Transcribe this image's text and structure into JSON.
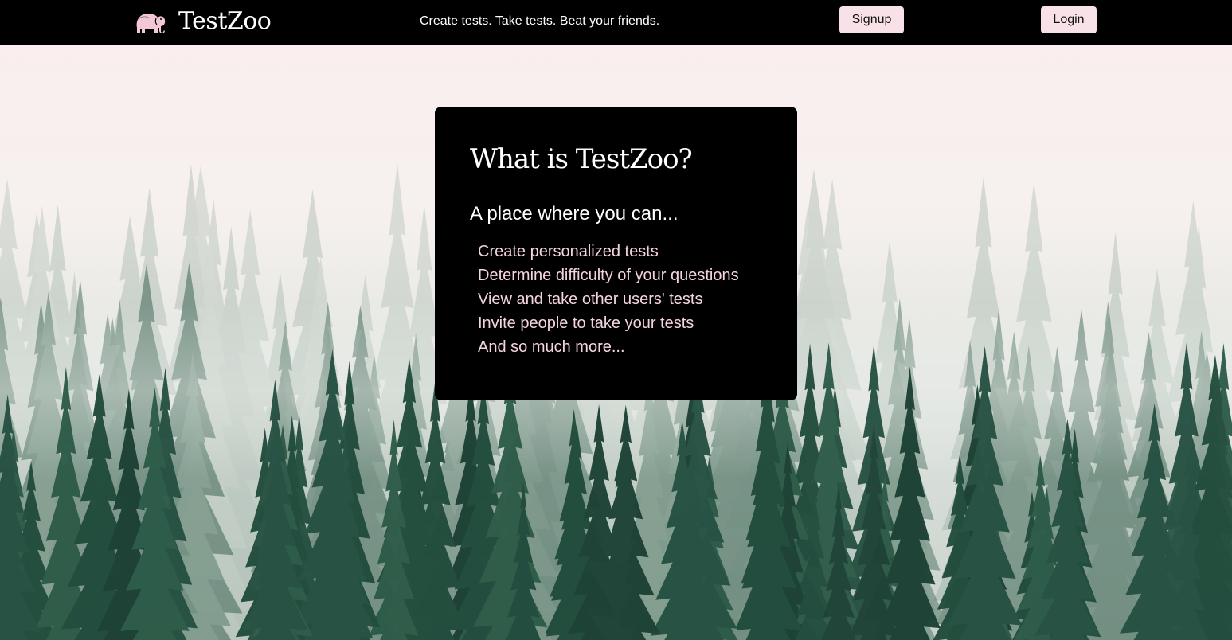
{
  "header": {
    "brand_name": "TestZoo",
    "brand_icon": "elephant-icon",
    "tagline": "Create tests. Take tests. Beat your friends.",
    "signup_label": "Signup",
    "login_label": "Login"
  },
  "card": {
    "title": "What is TestZoo?",
    "subtitle": "A place where you can...",
    "features": [
      "Create personalized tests",
      "Determine difficulty of your questions",
      "View and take other users' tests",
      "Invite people to take your tests",
      "And so much more..."
    ]
  },
  "colors": {
    "navbar_bg": "#000000",
    "button_bg": "#f9e1e8",
    "card_bg": "#000000",
    "list_text": "#f6d4df",
    "brand_icon": "#f3c7d5"
  },
  "background": {
    "scene": "misty-pine-forest"
  }
}
